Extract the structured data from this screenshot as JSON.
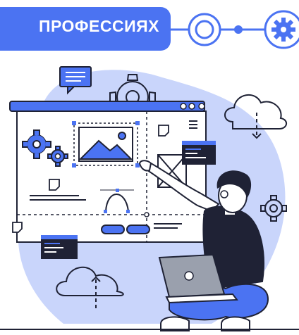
{
  "banner": {
    "text": "ПРОФЕССИЯХ"
  },
  "colors": {
    "accent": "#4b73f2",
    "light_blue": "#c9d5fb",
    "dark": "#1f2235",
    "white": "#ffffff"
  },
  "icons": [
    "circle-node-icon",
    "gear-node-icon",
    "chat-bubble-icon",
    "gear-icon",
    "image-icon",
    "cloud-download-icon",
    "cloud-upload-icon",
    "laptop-icon",
    "note-icon"
  ]
}
